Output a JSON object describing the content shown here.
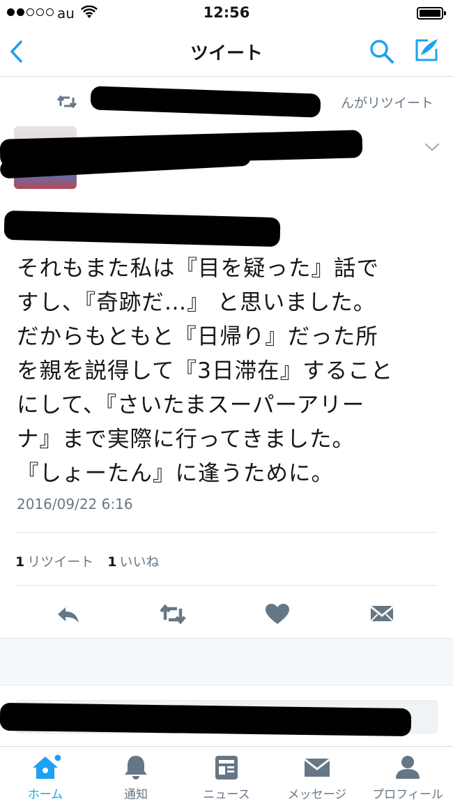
{
  "status_bar": {
    "carrier": "au",
    "time": "12:56"
  },
  "nav": {
    "title": "ツイート"
  },
  "tweet": {
    "retweet_context": "んがリツイート",
    "text": "それもまた私は『目を疑った』話で\nすし、『奇跡だ…』 と思いました。\nだからもともと『日帰り』だった所\nを親を説得して『3日滞在』すること\nにして、『さいたまスーパーアリー\nナ』まで実際に行ってきました。\n『しょーたん』に逢うために。",
    "timestamp": "2016/09/22 6:16",
    "retweet_count": "1",
    "retweet_label": "リツイート",
    "like_count": "1",
    "like_label": "いいね"
  },
  "tabs": [
    {
      "label": "ホーム",
      "icon": "home-icon",
      "active": true
    },
    {
      "label": "通知",
      "icon": "bell-icon"
    },
    {
      "label": "ニュース",
      "icon": "news-icon"
    },
    {
      "label": "メッセージ",
      "icon": "envelope-icon"
    },
    {
      "label": "プロフィール",
      "icon": "profile-icon"
    }
  ],
  "colors": {
    "accent": "#1da1f2",
    "icon_gray": "#657786",
    "text": "#14171a"
  }
}
